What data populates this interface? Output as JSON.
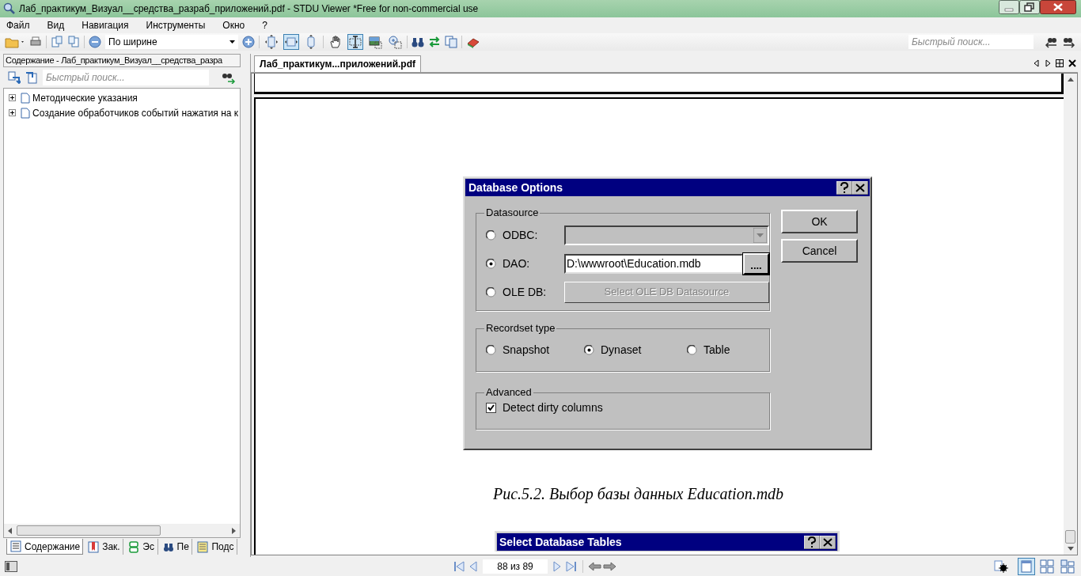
{
  "window": {
    "title": "Лаб_практикум_Визуал__средства_разраб_приложений.pdf - STDU Viewer *Free for non-commercial use"
  },
  "menu": [
    "Файл",
    "Вид",
    "Навигация",
    "Инструменты",
    "Окно",
    "?"
  ],
  "toolbar": {
    "zoom": "По ширине",
    "quick_search": {
      "placeholder": "Быстрый поиск..."
    },
    "tools": [
      {
        "kind": "fit-page",
        "selected": false
      },
      {
        "kind": "fit-width",
        "selected": true
      },
      {
        "kind": "fit-height",
        "selected": false
      },
      {
        "kind": "hand",
        "selected": false
      },
      {
        "kind": "text-select",
        "selected": true
      },
      {
        "kind": "image-select",
        "selected": false
      },
      {
        "kind": "zoom-select",
        "selected": false
      }
    ]
  },
  "left_panel": {
    "header": "Содержание - Лаб_практикум_Визуал__средства_разра",
    "search": {
      "placeholder": "Быстрый поиск..."
    },
    "tree": [
      {
        "label": "Методические указания",
        "expanded": false
      },
      {
        "label": "Создание обработчиков событий нажатия на к",
        "expanded": false
      }
    ],
    "tabs": [
      {
        "label": "Содержание",
        "kind": "contents",
        "selected": true
      },
      {
        "label": "Зак.",
        "kind": "bookmarks",
        "selected": false
      },
      {
        "label": "Эс",
        "kind": "thumbnails",
        "selected": false
      },
      {
        "label": "Пе",
        "kind": "search",
        "selected": false
      },
      {
        "label": "Подс",
        "kind": "notes",
        "selected": false
      }
    ]
  },
  "document_tab": {
    "label": "Лаб_практикум...приложений.pdf",
    "selected": true
  },
  "page": {
    "dialog": {
      "title": "Database Options",
      "datasource": {
        "label": "Datasource",
        "options": [
          {
            "label": "ODBC:",
            "kind": "dropdown",
            "selected": false
          },
          {
            "label": "DAO:",
            "kind": "path",
            "selected": true,
            "value": "D:\\wwwroot\\Education.mdb",
            "browse": "...."
          },
          {
            "label": "OLE DB:",
            "kind": "button",
            "selected": false,
            "button": "Select OLE DB Datasource"
          }
        ]
      },
      "recordset": {
        "label": "Recordset type",
        "options": [
          {
            "label": "Snapshot",
            "selected": false
          },
          {
            "label": "Dynaset",
            "selected": true
          },
          {
            "label": "Table",
            "selected": false
          }
        ]
      },
      "advanced": {
        "label": "Advanced",
        "checkbox": {
          "label": "Detect dirty columns",
          "checked": true
        }
      },
      "buttons": [
        "OK",
        "Cancel"
      ]
    },
    "caption": "Рис.5.2. Выбор базы данных Education.mdb",
    "next_dialog": {
      "title": "Select Database Tables"
    }
  },
  "status_bar": {
    "page": "88 из 89",
    "views": [
      {
        "kind": "single",
        "selected": true
      },
      {
        "kind": "grid",
        "selected": false
      },
      {
        "kind": "grid-alt",
        "selected": false
      }
    ]
  }
}
